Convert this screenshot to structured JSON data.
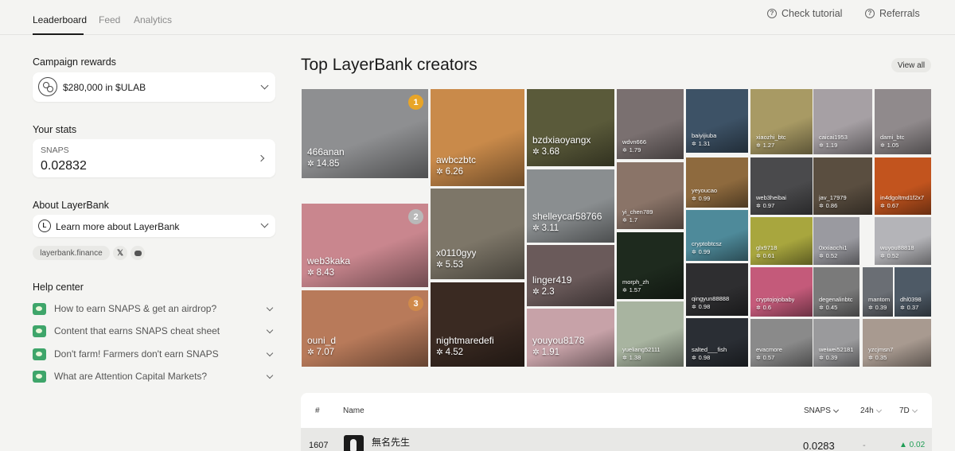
{
  "nav": {
    "tabs": [
      {
        "label": "Leaderboard"
      },
      {
        "label": "Feed"
      },
      {
        "label": "Analytics"
      }
    ],
    "check_tutorial": "Check tutorial",
    "referrals": "Referrals"
  },
  "campaign": {
    "title": "Campaign rewards",
    "reward": "$280,000 in $ULAB"
  },
  "stats": {
    "title": "Your stats",
    "label": "SNAPS",
    "value": "0.02832"
  },
  "about": {
    "title": "About LayerBank",
    "link": "Learn more about LayerBank",
    "website": "layerbank.finance"
  },
  "help": {
    "title": "Help center",
    "items": [
      {
        "label": "How to earn SNAPS & get an airdrop?"
      },
      {
        "label": "Content that earns SNAPS cheat sheet"
      },
      {
        "label": "Don't farm! Farmers don't earn SNAPS"
      },
      {
        "label": "What are Attention Capital Markets?"
      }
    ]
  },
  "main": {
    "title": "Top LayerBank creators",
    "view_all": "View all"
  },
  "creators": [
    {
      "name": "466anan",
      "score": "14.85",
      "rank": "1",
      "color": "#8e8f91"
    },
    {
      "name": "web3kaka",
      "score": "8.43",
      "rank": "2",
      "color": "#c9868e"
    },
    {
      "name": "ouni_d",
      "score": "7.07",
      "rank": "3",
      "color": "#b87a5a"
    },
    {
      "name": "awbczbtc",
      "score": "6.26",
      "color": "#c98a4a"
    },
    {
      "name": "x0110gyy",
      "score": "5.53",
      "color": "#7d7668"
    },
    {
      "name": "nightmaredefi",
      "score": "4.52",
      "color": "#3a2a22"
    },
    {
      "name": "bzdxiaoyangx",
      "score": "3.68",
      "color": "#5a5a3a"
    },
    {
      "name": "shelleycar58766",
      "score": "3.11",
      "color": "#8a8e90"
    },
    {
      "name": "linger419",
      "score": "2.3",
      "color": "#6a5a5a"
    },
    {
      "name": "youyou8178",
      "score": "1.91",
      "color": "#c7a2a8"
    },
    {
      "name": "wdvn666",
      "score": "1.79",
      "color": "#7a7070"
    },
    {
      "name": "yi_chen789",
      "score": "1.7",
      "color": "#8a7468"
    },
    {
      "name": "morph_zh",
      "score": "1.57",
      "color": "#1e2a1e"
    },
    {
      "name": "yueliang52111",
      "score": "1.38",
      "color": "#a8b4a0"
    },
    {
      "name": "baiyijiuba",
      "score": "1.31",
      "color": "#3d5266"
    },
    {
      "name": "yeyoucao",
      "score": "0.99",
      "color": "#8e6a3e"
    },
    {
      "name": "cryptobtcsz",
      "score": "0.99",
      "color": "#4e8a9a"
    },
    {
      "name": "qingyun88888",
      "score": "0.98",
      "color": "#2e2e30"
    },
    {
      "name": "salted___fish",
      "score": "0.98",
      "color": "#2a2e34"
    },
    {
      "name": "xiaozhi_btc",
      "score": "1.27",
      "color": "#a89a64"
    },
    {
      "name": "web3heibai",
      "score": "0.97",
      "color": "#4a4a4c"
    },
    {
      "name": "glx9718",
      "score": "0.61",
      "color": "#a8a63e"
    },
    {
      "name": "cryptojojobaby",
      "score": "0.6",
      "color": "#c45a7a"
    },
    {
      "name": "evacmore",
      "score": "0.57",
      "color": "#8a8a8a"
    },
    {
      "name": "caicai1953",
      "score": "1.19",
      "color": "#a6a0a4"
    },
    {
      "name": "jav_17979",
      "score": "0.86",
      "color": "#5a4e40"
    },
    {
      "name": "0xxiaochi1",
      "score": "0.52",
      "color": "#9a9aa0"
    },
    {
      "name": "degenalinbtc",
      "score": "0.45",
      "color": "#7a7a7a"
    },
    {
      "name": "mantom",
      "score": "0.39",
      "color": "#6a6e74"
    },
    {
      "name": "weiwei52181",
      "score": "0.39",
      "color": "#9a9a9c"
    },
    {
      "name": "dami_btc",
      "score": "1.05",
      "color": "#908a8c"
    },
    {
      "name": "in4dgoltmd1f2x7",
      "score": "0.67",
      "color": "#c2541e"
    },
    {
      "name": "wuyou88818",
      "score": "0.52",
      "color": "#b4b4b8"
    },
    {
      "name": "dhl0398",
      "score": "0.37",
      "color": "#4e5a66"
    },
    {
      "name": "yzcjmsn7",
      "score": "0.35",
      "color": "#a89a90"
    }
  ],
  "table": {
    "col_rank": "#",
    "col_name": "Name",
    "col_snaps": "SNAPS",
    "col_24h": "24h",
    "col_7d": "7D",
    "row": {
      "rank": "1607",
      "name": "無名先生",
      "snaps": "0.0283",
      "change_24h": "-",
      "change_7d": "▲ 0.02"
    }
  },
  "colors": {
    "accent_green": "#3ea56a",
    "gold": "#e8a528",
    "silver": "#b9b9b9",
    "bronze": "#d08a4a",
    "positive": "#1f9d55"
  }
}
